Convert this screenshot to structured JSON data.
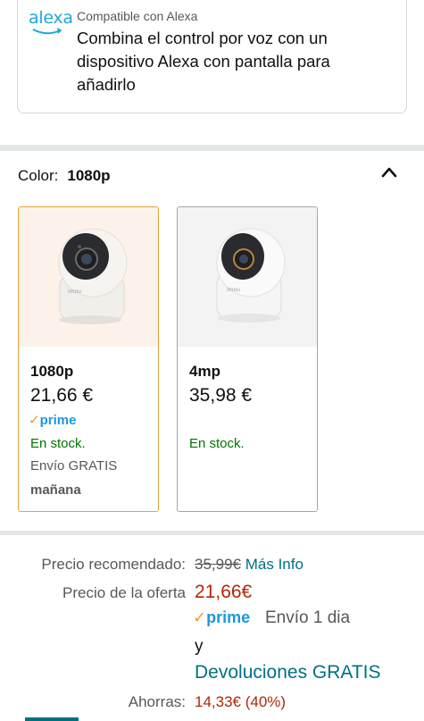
{
  "alexa": {
    "logo": "alexa",
    "compatible": "Compatible con Alexa",
    "description": "Combina el control por voz con un dispositivo Alexa con pantalla para añadirlo"
  },
  "color": {
    "label": "Color:",
    "selected": "1080p",
    "icon": "chevron-up-icon"
  },
  "variants": [
    {
      "name": "1080p",
      "price": "21,66 €",
      "prime": "prime",
      "stock": "En stock.",
      "shipping": "Envío GRATIS",
      "delivery": "mañana",
      "selected": true
    },
    {
      "name": "4mp",
      "price": "35,98 €",
      "stock": "En stock.",
      "selected": false
    }
  ],
  "pricing": {
    "recommended_label": "Precio recomendado:",
    "recommended_value": "35,99€",
    "more_info": "Más Info",
    "offer_label": "Precio de la oferta",
    "offer_value": "21,66€",
    "prime": "prime",
    "shipping": "Envío 1 dia",
    "and": "y",
    "returns": "Devoluciones GRATIS",
    "savings_label": "Ahorras:",
    "savings_value": "14,33€ (40%)"
  },
  "colors": {
    "link": "#007185",
    "price_red": "#b12704",
    "stock_green": "#007600",
    "prime_blue": "#1b98e0",
    "selected_border": "#e7a33e"
  }
}
